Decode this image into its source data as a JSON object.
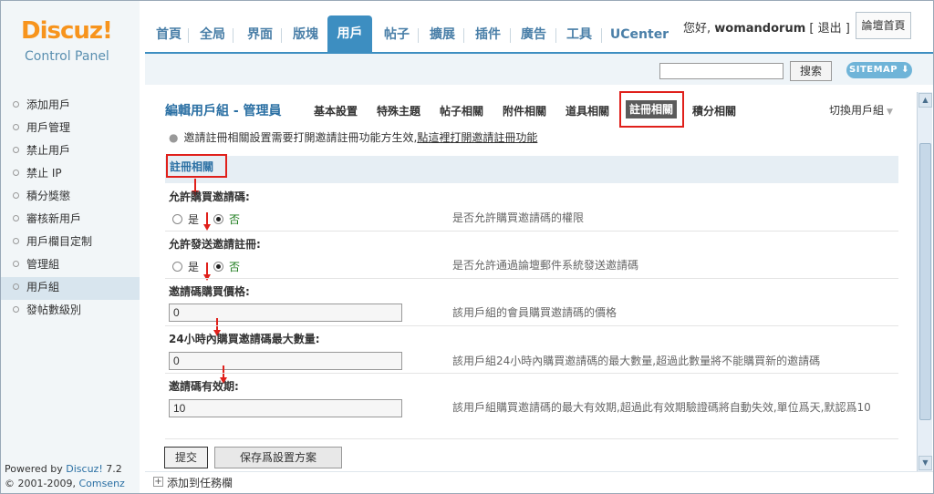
{
  "logo": {
    "brand": "Discuz!",
    "subtitle": "Control Panel"
  },
  "nav": {
    "tabs": [
      "首頁",
      "全局",
      "界面",
      "版塊",
      "用戶",
      "帖子",
      "擴展",
      "插件",
      "廣告",
      "工具",
      "UCenter"
    ],
    "active": "用戶"
  },
  "user": {
    "greeting": "您好,",
    "name": "womandorum",
    "logout": "[ 退出 ]",
    "forum_home": "論壇首頁"
  },
  "search": {
    "value": "",
    "button": "搜索",
    "sitemap": "SITEMAP ⬇"
  },
  "sidebar": {
    "items": [
      "添加用戶",
      "用戶管理",
      "禁止用戶",
      "禁止 IP",
      "積分獎懲",
      "審核新用戶",
      "用戶欄目定制",
      "管理組",
      "用戶組",
      "發帖數級別"
    ],
    "active": "用戶組"
  },
  "powered": {
    "prefix": "Powered by ",
    "product": "Discuz!",
    "version": " 7.2",
    "copyright": "© 2001-2009, ",
    "company": "Comsenz Inc."
  },
  "page": {
    "title": "編輯用戶組 - 管理員",
    "subtabs": [
      "基本設置",
      "特殊主題",
      "帖子相關",
      "附件相關",
      "道具相關",
      "註冊相關",
      "積分相關"
    ],
    "active_subtab": "註冊相關",
    "switch_group": "切換用戶組",
    "notice_text": "邀請註冊相關設置需要打開邀請註冊功能方生效,",
    "notice_link": "點這裡打開邀請註冊功能",
    "section_title": "註冊相關",
    "fields": [
      {
        "label": "允許購買邀請碼:",
        "type": "radio",
        "options": [
          "是",
          "否"
        ],
        "selected": "否",
        "hint": "是否允許購買邀請碼的權限"
      },
      {
        "label": "允許發送邀請註冊:",
        "type": "radio",
        "options": [
          "是",
          "否"
        ],
        "selected": "否",
        "hint": "是否允許通過論壇郵件系統發送邀請碼"
      },
      {
        "label": "邀請碼購買價格:",
        "type": "text",
        "value": "0",
        "hint": "該用戶組的會員購買邀請碼的價格"
      },
      {
        "label": "24小時內購買邀請碼最大數量:",
        "type": "text",
        "value": "0",
        "hint": "該用戶組24小時內購買邀請碼的最大數量,超過此數量將不能購買新的邀請碼"
      },
      {
        "label": "邀請碼有效期:",
        "type": "text",
        "value": "10",
        "hint": "該用戶組購買邀請碼的最大有效期,超過此有效期驗證碼將自動失效,單位爲天,默認爲10"
      }
    ],
    "submit": "提交",
    "save_plan": "保存爲設置方案"
  },
  "footer": {
    "add_to_taskbar": "添加到任務欄"
  },
  "colors": {
    "accent": "#3d8ec1",
    "highlight": "#e0201b",
    "brand": "#f7941d"
  }
}
